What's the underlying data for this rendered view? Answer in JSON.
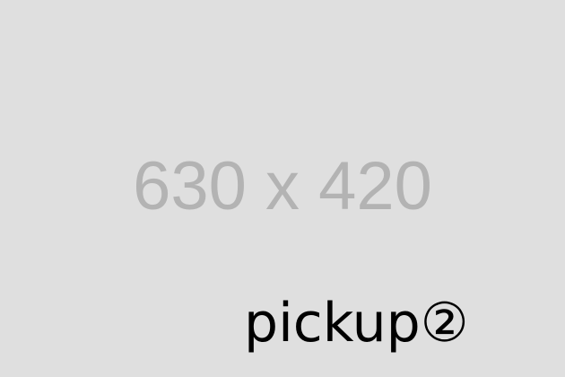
{
  "placeholder": {
    "dimensions_text": "630 x 420",
    "caption": "pickup②"
  }
}
